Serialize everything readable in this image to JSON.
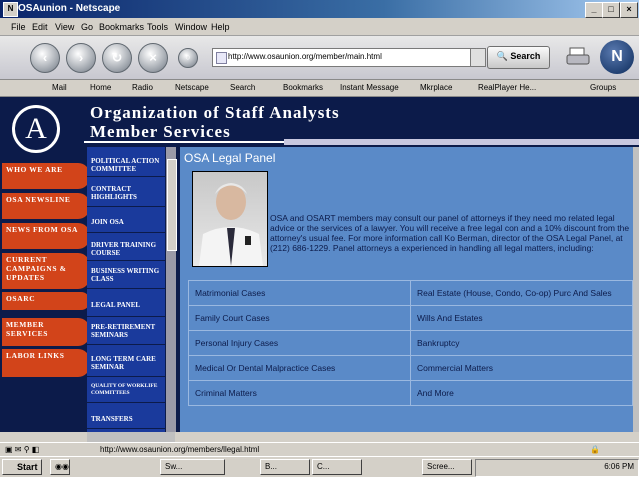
{
  "window": {
    "title": "OSAunion - Netscape"
  },
  "menu": [
    "File",
    "Edit",
    "View",
    "Go",
    "Bookmarks",
    "Tools",
    "Window",
    "Help"
  ],
  "toolbar": {
    "url": "http://www.osaunion.org/member/main.html",
    "search_label": "Search"
  },
  "personal_toolbar": [
    "Mail",
    "Home",
    "Radio",
    "Netscape",
    "Search",
    "Bookmarks",
    "Instant Message",
    "Mkrplace",
    "RealPlayer He...",
    "Groups"
  ],
  "header": {
    "line1": "Organization of Staff Analysts",
    "line2": "Member Services"
  },
  "left_tabs": [
    "Who We Are",
    "OSA Newsline",
    "News from OSA",
    "Current Campaigns & Updates",
    "OSARC",
    "Member Services",
    "Labor Links"
  ],
  "mid_nav": [
    "Political Action Committee",
    "Contract Highlights",
    "Join OSA",
    "Driver Training Course",
    "Business Writing Class",
    "Legal Panel",
    "Pre-Retirement Seminars",
    "Long Term Care Seminar",
    "Quality of Worklife Committees",
    "Transfers"
  ],
  "content": {
    "title": "OSA Legal Panel",
    "paragraph": "OSA and OSART members may consult our panel of attorneys if they need mo related legal advice or the services of a lawyer. You will receive a free legal con and a 10% discount from the attorney's usual fee. For more information call Ko Berman, director of the OSA Legal Panel, at (212) 686-1229. Panel attorneys a experienced in handling all legal matters, including:",
    "table": [
      [
        "Matrimonial Cases",
        "Real Estate (House, Condo, Co-op) Purc And Sales"
      ],
      [
        "Family Court Cases",
        "Wills And Estates"
      ],
      [
        "Personal Injury Cases",
        "Bankruptcy"
      ],
      [
        "Medical Or Dental Malpractice Cases",
        "Commercial Matters"
      ],
      [
        "Criminal Matters",
        "And More"
      ]
    ]
  },
  "status": {
    "text": "http://www.osaunion.org/members/llegal.html"
  },
  "taskbar": {
    "start": "Start",
    "buttons": [
      "Sw...",
      "B...",
      "C...",
      "Scree..."
    ],
    "clock": "6:06 PM"
  },
  "colors": {
    "page_bg": "#0c1b4a",
    "accent_red": "#d2441a",
    "nav_blue": "#1a3a9c",
    "content_blue": "#5a8ac8"
  }
}
